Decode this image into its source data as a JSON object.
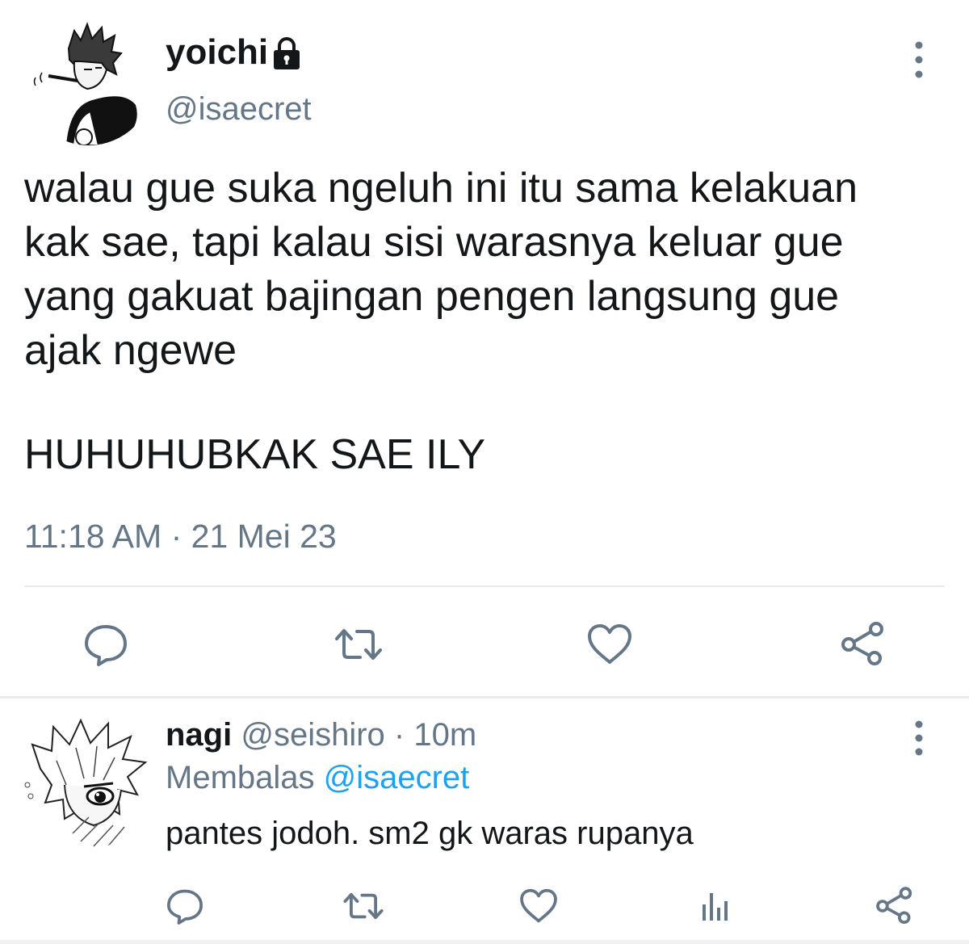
{
  "tweet": {
    "display_name": "yoichi",
    "handle": "@isaecret",
    "text_lines": [
      "walau gue suka ngeluh ini itu sama kelakuan",
      "kak sae, tapi kalau sisi warasnya keluar gue",
      "yang gakuat bajingan pengen langsung gue",
      "ajak ngewe"
    ],
    "text_shout": "HUHUHUBKAK SAE ILY",
    "timestamp": "11:18 AM · 21 Mei 23",
    "icons": {
      "lock": "lock-icon",
      "more": "more-vertical-icon",
      "actions": [
        "reply-icon",
        "retweet-icon",
        "like-icon",
        "share-icon"
      ]
    }
  },
  "reply": {
    "display_name": "nagi",
    "meta": " @seishiro · 10m",
    "reply_prefix": "Membalas ",
    "reply_handle": "@isaecret",
    "text": "pantes jodoh. sm2 gk waras rupanya",
    "icons": {
      "more": "more-vertical-icon",
      "actions": [
        "reply-icon",
        "retweet-icon",
        "like-icon",
        "analytics-icon",
        "share-icon"
      ]
    }
  },
  "colors": {
    "text_primary": "#14171a",
    "text_secondary": "#657786",
    "icon_gray": "#657786",
    "link_blue": "#1da1f2",
    "divider": "#e6ecf0"
  }
}
